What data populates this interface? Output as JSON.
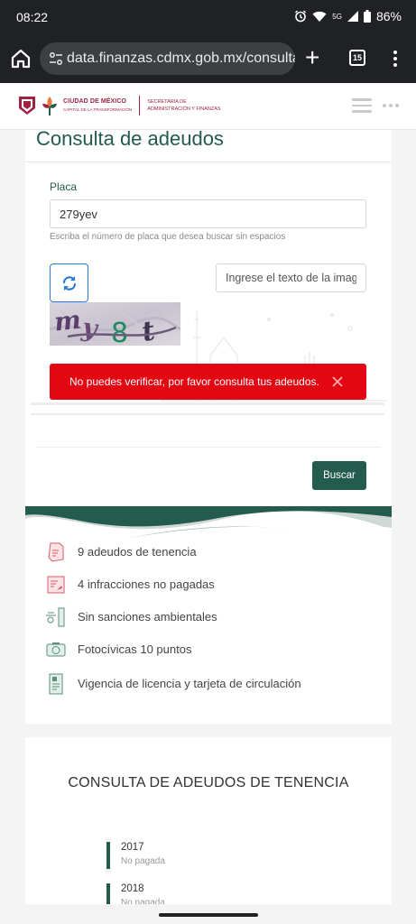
{
  "status_bar": {
    "time": "08:22",
    "network": "5G",
    "battery": "86%"
  },
  "browser": {
    "url": "data.finanzas.cdmx.gob.mx/consulta_a",
    "tab_count": "15"
  },
  "site_header": {
    "logo_title": "CIUDAD DE MÉXICO",
    "logo_subtitle": "CAPITAL DE LA TRANSFORMACIÓN",
    "secretaria_line1": "SECRETARÍA DE",
    "secretaria_line2": "ADMINISTRACIÓN Y FINANZAS"
  },
  "form": {
    "title": "Consulta de adeudos",
    "placa_label": "Placa",
    "placa_value": "279yev",
    "placa_help": "Escriba el número de placa que desea buscar sin espacios",
    "captcha_placeholder": "Ingrese el texto de la imag",
    "captcha_text": "my8t",
    "error_message": "No puedes verificar, por favor consulta tus adeudos.",
    "search_button": "Buscar"
  },
  "info_items": [
    {
      "icon": "tenencia-document-icon",
      "label": "9 adeudos de tenencia"
    },
    {
      "icon": "infraccion-ticket-icon",
      "label": "4 infracciones no pagadas"
    },
    {
      "icon": "ambiental-bike-icon",
      "label": "Sin sanciones ambientales"
    },
    {
      "icon": "fotocivica-camera-icon",
      "label": "Fotocívicas 10 puntos"
    },
    {
      "icon": "licencia-card-icon",
      "label": "Vigencia de licencia y tarjeta de circulación"
    }
  ],
  "tenencia": {
    "title": "CONSULTA DE ADEUDOS DE TENENCIA",
    "years": [
      {
        "year": "2017",
        "status": "No pagada"
      },
      {
        "year": "2018",
        "status": "No pagada"
      }
    ]
  },
  "colors": {
    "brand_green": "#235b4e",
    "brand_guinda": "#9f2241",
    "error_red": "#e30613"
  }
}
